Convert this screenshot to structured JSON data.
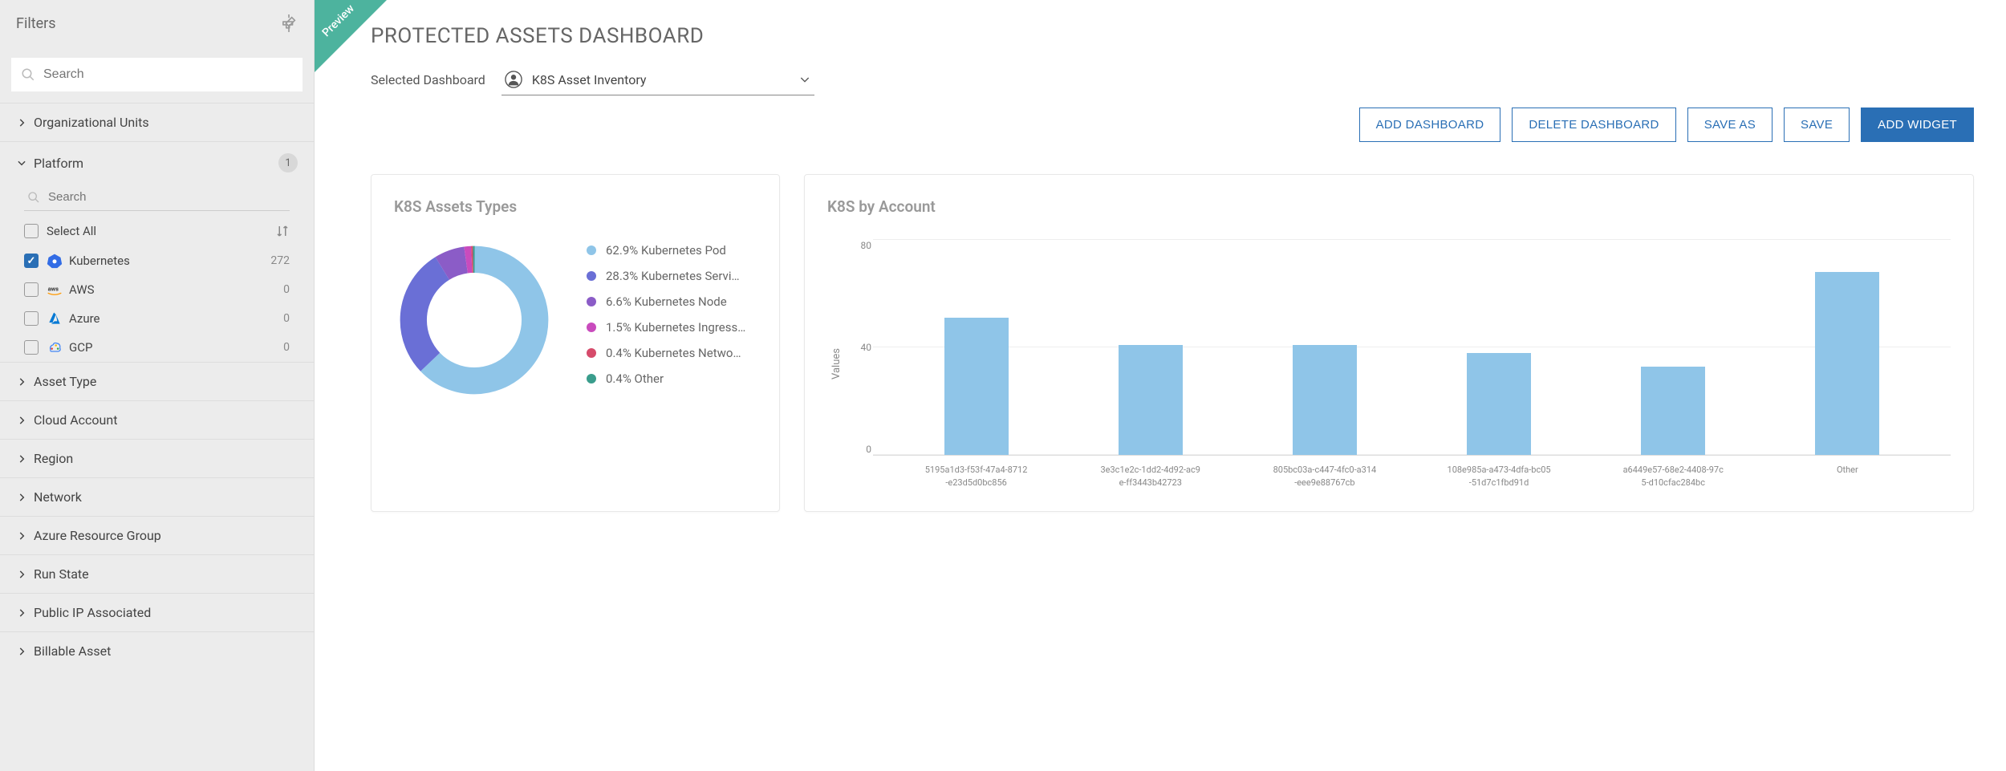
{
  "sidebar": {
    "title": "Filters",
    "search_placeholder": "Search",
    "groups": [
      {
        "label": "Organizational Units",
        "expanded": false
      },
      {
        "label": "Platform",
        "expanded": true,
        "count": "1",
        "search_placeholder": "Search",
        "select_all": "Select All",
        "items": [
          {
            "label": "Kubernetes",
            "count": "272",
            "checked": true,
            "icon": "kubernetes"
          },
          {
            "label": "AWS",
            "count": "0",
            "checked": false,
            "icon": "aws"
          },
          {
            "label": "Azure",
            "count": "0",
            "checked": false,
            "icon": "azure"
          },
          {
            "label": "GCP",
            "count": "0",
            "checked": false,
            "icon": "gcp"
          }
        ]
      },
      {
        "label": "Asset Type",
        "expanded": false
      },
      {
        "label": "Cloud Account",
        "expanded": false
      },
      {
        "label": "Region",
        "expanded": false
      },
      {
        "label": "Network",
        "expanded": false
      },
      {
        "label": "Azure Resource Group",
        "expanded": false
      },
      {
        "label": "Run State",
        "expanded": false
      },
      {
        "label": "Public IP Associated",
        "expanded": false
      },
      {
        "label": "Billable Asset",
        "expanded": false
      }
    ]
  },
  "header": {
    "preview": "Preview",
    "title": "PROTECTED ASSETS DASHBOARD",
    "selected_label": "Selected Dashboard",
    "dashboard_name": "K8S Asset Inventory"
  },
  "toolbar": {
    "add_dashboard": "ADD DASHBOARD",
    "delete_dashboard": "DELETE DASHBOARD",
    "save_as": "SAVE AS",
    "save": "SAVE",
    "add_widget": "ADD WIDGET"
  },
  "widgets": {
    "asset_types": {
      "title": "K8S Assets Types"
    },
    "by_account": {
      "title": "K8S by Account"
    }
  },
  "chart_data": [
    {
      "type": "pie",
      "title": "K8S Assets Types",
      "series": [
        {
          "name": "Kubernetes Pod",
          "value": 62.9,
          "color": "#8fc5e8"
        },
        {
          "name": "Kubernetes Servi…",
          "value": 28.3,
          "color": "#6a6fd6"
        },
        {
          "name": "Kubernetes Node",
          "value": 6.6,
          "color": "#8b5cc7"
        },
        {
          "name": "Kubernetes Ingress…",
          "value": 1.5,
          "color": "#c94bbd"
        },
        {
          "name": "Kubernetes Netwo…",
          "value": 0.4,
          "color": "#d64b6b"
        },
        {
          "name": "Other",
          "value": 0.4,
          "color": "#3a9d8c"
        }
      ]
    },
    {
      "type": "bar",
      "title": "K8S by Account",
      "ylabel": "Values",
      "ylim": [
        0,
        80
      ],
      "yticks": [
        0,
        40,
        80
      ],
      "categories": [
        "5195a1d3-f53f-47a4-8712-e23d5d0bc856",
        "3e3c1e2c-1dd2-4d92-ac9e-ff3443b42723",
        "805bc03a-c447-4fc0-a314-eee9e88767cb",
        "108e985a-a473-4dfa-bc05-51d7c1fbd91d",
        "a6449e57-68e2-4408-97c5-d10cfac284bc",
        "Other"
      ],
      "values": [
        51,
        41,
        41,
        38,
        33,
        68
      ],
      "color": "#8fc5e8"
    }
  ]
}
